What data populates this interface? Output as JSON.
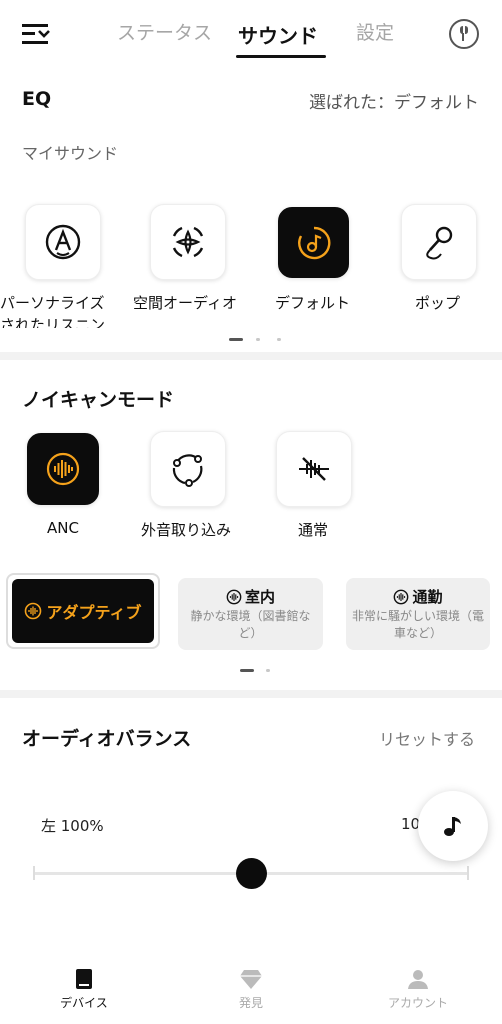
{
  "header": {
    "tabs": [
      {
        "label": "ステータス"
      },
      {
        "label": "サウンド"
      },
      {
        "label": "設定"
      }
    ]
  },
  "eq": {
    "title": "EQ",
    "selected_text": "選ばれた：デフォルト",
    "my_sound_label": "マイサウンド",
    "presets": [
      {
        "label": "パーソナライズされたリスニン",
        "icon": "personalized-listening-icon"
      },
      {
        "label": "空間オーディオ",
        "icon": "spatial-audio-icon"
      },
      {
        "label": "デフォルト",
        "icon": "default-eq-icon"
      },
      {
        "label": "ポップ",
        "icon": "pop-microphone-icon"
      }
    ]
  },
  "noise_cancel": {
    "title": "ノイキャンモード",
    "modes": [
      {
        "label": "ANC",
        "icon": "anc-waveform-icon"
      },
      {
        "label": "外音取り込み",
        "icon": "ambient-sound-icon"
      },
      {
        "label": "通常",
        "icon": "normal-mode-icon"
      }
    ],
    "anc_modes": {
      "adaptive": {
        "label": "アダプティブ"
      },
      "indoor": {
        "label": "室内",
        "description": "静かな環境（図書館など）"
      },
      "commute": {
        "label": "通勤",
        "description": "非常に騒がしい環境（電車など）"
      }
    }
  },
  "balance": {
    "title": "オーディオバランス",
    "reset_label": "リセットする",
    "left_label": "左 100%",
    "right_label": "10",
    "position": 0.5
  },
  "bottom_nav": {
    "items": [
      {
        "label": "デバイス",
        "icon": "device-icon"
      },
      {
        "label": "発見",
        "icon": "diamond-icon"
      },
      {
        "label": "アカウント",
        "icon": "account-icon"
      }
    ]
  },
  "colors": {
    "accent": "#f5a21b",
    "dark": "#0c0c0c",
    "muted": "#a6a6a6"
  }
}
